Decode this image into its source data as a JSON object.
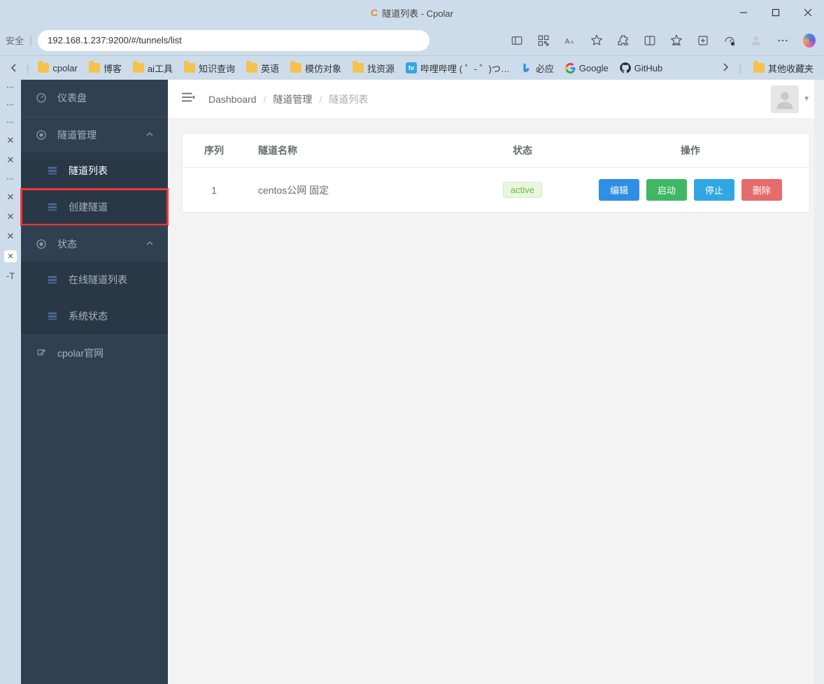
{
  "window": {
    "title": "隧道列表 - Cpolar",
    "icon_text": "C"
  },
  "addressbar": {
    "security_label": "安全",
    "url": "192.168.1.237:9200/#/tunnels/list"
  },
  "bookmarks": {
    "items": [
      {
        "label": "cpolar",
        "icon": "folder"
      },
      {
        "label": "博客",
        "icon": "folder"
      },
      {
        "label": "ai工具",
        "icon": "folder"
      },
      {
        "label": "知识查询",
        "icon": "folder"
      },
      {
        "label": "英语",
        "icon": "folder"
      },
      {
        "label": "模仿对象",
        "icon": "folder"
      },
      {
        "label": "找资源",
        "icon": "folder"
      },
      {
        "label": "哔哩哔哩 (  ゜- ゜)つ…",
        "icon": "bili"
      },
      {
        "label": "必应",
        "icon": "bing"
      },
      {
        "label": "Google",
        "icon": "google"
      },
      {
        "label": "GitHub",
        "icon": "github"
      }
    ],
    "overflow_label": "其他收藏夹"
  },
  "gutter": {
    "bottom_label": "-T"
  },
  "sidebar": {
    "dashboard": "仪表盘",
    "tunnels_group": "隧道管理",
    "tunnels_list": "隧道列表",
    "tunnels_create": "创建隧道",
    "status_group": "状态",
    "status_online": "在线隧道列表",
    "status_system": "系统状态",
    "official": "cpolar官网"
  },
  "breadcrumb": {
    "root": "Dashboard",
    "group": "隧道管理",
    "current": "隧道列表"
  },
  "table": {
    "headers": {
      "index": "序列",
      "name": "隧道名称",
      "status": "状态",
      "ops": "操作"
    },
    "rows": [
      {
        "index": "1",
        "name": "centos公网 固定",
        "status": "active"
      }
    ],
    "buttons": {
      "edit": "编辑",
      "start": "启动",
      "stop": "停止",
      "delete": "删除"
    }
  }
}
